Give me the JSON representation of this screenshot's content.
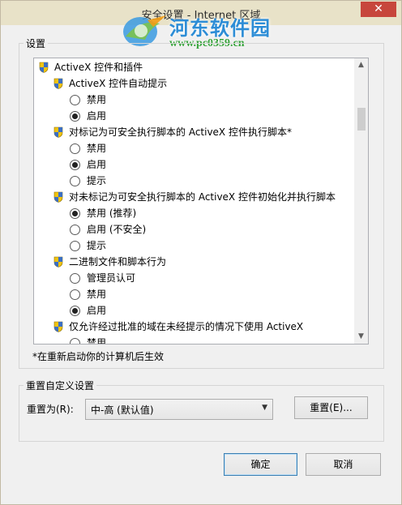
{
  "window": {
    "title": "安全设置 - Internet 区域",
    "close_glyph": "✕"
  },
  "watermark": {
    "title": "河东软件园",
    "url": "www.pc0359.cn"
  },
  "settings_group": {
    "label": "设置"
  },
  "tree": {
    "items": [
      {
        "type": "header",
        "label": "ActiveX 控件和插件"
      },
      {
        "type": "setting",
        "label": "ActiveX 控件自动提示"
      },
      {
        "type": "radio",
        "label": "禁用",
        "checked": false
      },
      {
        "type": "radio",
        "label": "启用",
        "checked": true
      },
      {
        "type": "setting",
        "label": "对标记为可安全执行脚本的 ActiveX 控件执行脚本*"
      },
      {
        "type": "radio",
        "label": "禁用",
        "checked": false
      },
      {
        "type": "radio",
        "label": "启用",
        "checked": true
      },
      {
        "type": "radio",
        "label": "提示",
        "checked": false
      },
      {
        "type": "setting",
        "label": "对未标记为可安全执行脚本的 ActiveX 控件初始化并执行脚本"
      },
      {
        "type": "radio",
        "label": "禁用 (推荐)",
        "checked": true
      },
      {
        "type": "radio",
        "label": "启用 (不安全)",
        "checked": false
      },
      {
        "type": "radio",
        "label": "提示",
        "checked": false
      },
      {
        "type": "setting",
        "label": "二进制文件和脚本行为"
      },
      {
        "type": "radio",
        "label": "管理员认可",
        "checked": false
      },
      {
        "type": "radio",
        "label": "禁用",
        "checked": false
      },
      {
        "type": "radio",
        "label": "启用",
        "checked": true
      },
      {
        "type": "setting",
        "label": "仅允许经过批准的域在未经提示的情况下使用 ActiveX"
      },
      {
        "type": "radio",
        "label": "禁用",
        "checked": false
      }
    ],
    "scroll_up_glyph": "▲",
    "scroll_down_glyph": "▼"
  },
  "note": "*在重新启动你的计算机后生效",
  "reset_group": {
    "label": "重置自定义设置",
    "reset_to_label": "重置为(R):",
    "selected_level": "中-高 (默认值)",
    "dropdown_glyph": "▼",
    "reset_button": "重置(E)..."
  },
  "footer": {
    "ok_button": "确定",
    "cancel_button": "取消"
  },
  "colors": {
    "close_button": "#c7463c",
    "watermark_blue": "#2d8dd6",
    "watermark_green": "#36a33a",
    "shield_yellow": "#f1c40f",
    "shield_blue": "#3b6fc4"
  }
}
